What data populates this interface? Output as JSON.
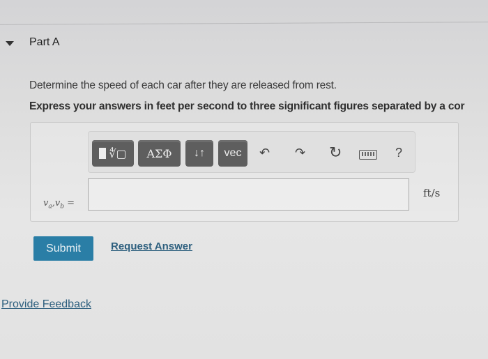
{
  "part": {
    "title": "Part A",
    "toggle_icon": "caret-down-icon"
  },
  "question": {
    "prompt": "Determine the speed of each car after they are released from rest.",
    "instruction": "Express your answers in feet per second to three significant figures separated by a cor"
  },
  "toolbar": {
    "templates_icon": "templates-radical-icon",
    "greek_label": "ΑΣΦ",
    "arrows_label": "↓↑",
    "vec_label": "vec",
    "undo_icon": "↶",
    "redo_icon": "↷",
    "reset_icon": "↻",
    "keyboard_icon": "keyboard-icon",
    "help_label": "?"
  },
  "answer": {
    "variable_a": "v",
    "sub_a": "a",
    "separator": ",",
    "variable_b": "v",
    "sub_b": "b",
    "equals": " =",
    "value": "",
    "unit": "ft/s"
  },
  "actions": {
    "submit_label": "Submit",
    "request_answer_label": "Request Answer"
  },
  "footer": {
    "feedback_label": "Provide Feedback"
  }
}
